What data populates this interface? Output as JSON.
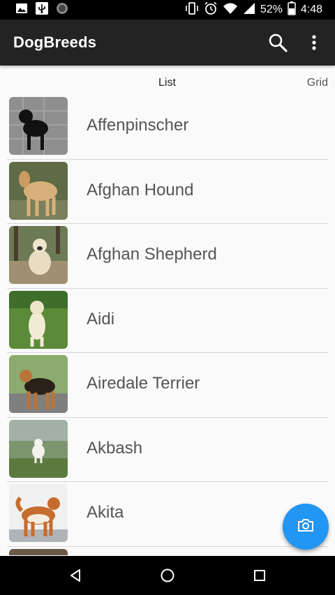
{
  "status_bar": {
    "battery_percent": "52%",
    "time": "4:48",
    "icons": [
      "image-icon",
      "usb-icon",
      "circle-notification-icon",
      "vibrate-icon",
      "alarm-icon",
      "wifi-icon",
      "signal-icon",
      "battery-icon"
    ]
  },
  "app_bar": {
    "title": "DogBreeds",
    "actions": [
      "search-icon",
      "overflow-menu-icon"
    ]
  },
  "tabs": {
    "list_label": "List",
    "grid_label": "Grid"
  },
  "breeds": [
    {
      "name": "Affenpinscher"
    },
    {
      "name": "Afghan Hound"
    },
    {
      "name": "Afghan Shepherd"
    },
    {
      "name": "Aidi"
    },
    {
      "name": "Airedale Terrier"
    },
    {
      "name": "Akbash"
    },
    {
      "name": "Akita"
    }
  ],
  "fab": {
    "icon": "camera-icon"
  },
  "nav_bar": {
    "icons": [
      "back-icon",
      "home-icon",
      "recents-icon"
    ]
  },
  "colors": {
    "app_bar": "#232323",
    "fab": "#2196f3",
    "background": "#fafafa"
  }
}
